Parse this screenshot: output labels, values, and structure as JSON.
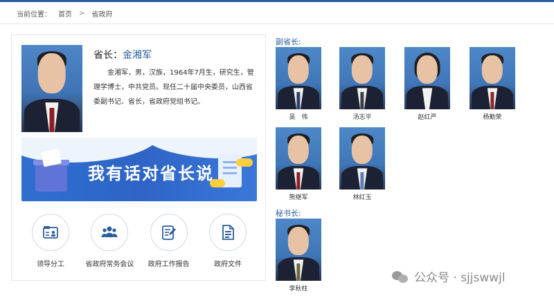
{
  "breadcrumb": {
    "label": "当前位置：",
    "home": "首页",
    "separator": ">",
    "current": "省政府"
  },
  "governor": {
    "title": "省长：",
    "name": "金湘军",
    "bio": "金湘军，男，汉族，1964年7月生，研究生，管理学博士，中共党员。现任二十届中央委员，山西省委副书记、省长，省政府党组书记。"
  },
  "banner": {
    "text": "我有话对省长说"
  },
  "quick_links": [
    {
      "label": "领导分工",
      "icon": "org-chart-icon"
    },
    {
      "label": "省政府常务会议",
      "icon": "meeting-group-icon"
    },
    {
      "label": "政府工作报告",
      "icon": "report-edit-icon"
    },
    {
      "label": "政府文件",
      "icon": "document-icon"
    }
  ],
  "vice_governors": {
    "title": "副省长:",
    "people": [
      {
        "name": "吴　伟"
      },
      {
        "name": "汤志平"
      },
      {
        "name": "赵红严"
      },
      {
        "name": "杨勤荣"
      },
      {
        "name": "熊继军"
      },
      {
        "name": "林红玉"
      }
    ]
  },
  "secretary_general": {
    "title": "秘书长:",
    "people": [
      {
        "name": "李秋柱"
      }
    ]
  },
  "watermark": {
    "text": "公众号 · sjjswwjl"
  },
  "colors": {
    "accent": "#2a5d9a",
    "banner": "#2e64c6"
  }
}
